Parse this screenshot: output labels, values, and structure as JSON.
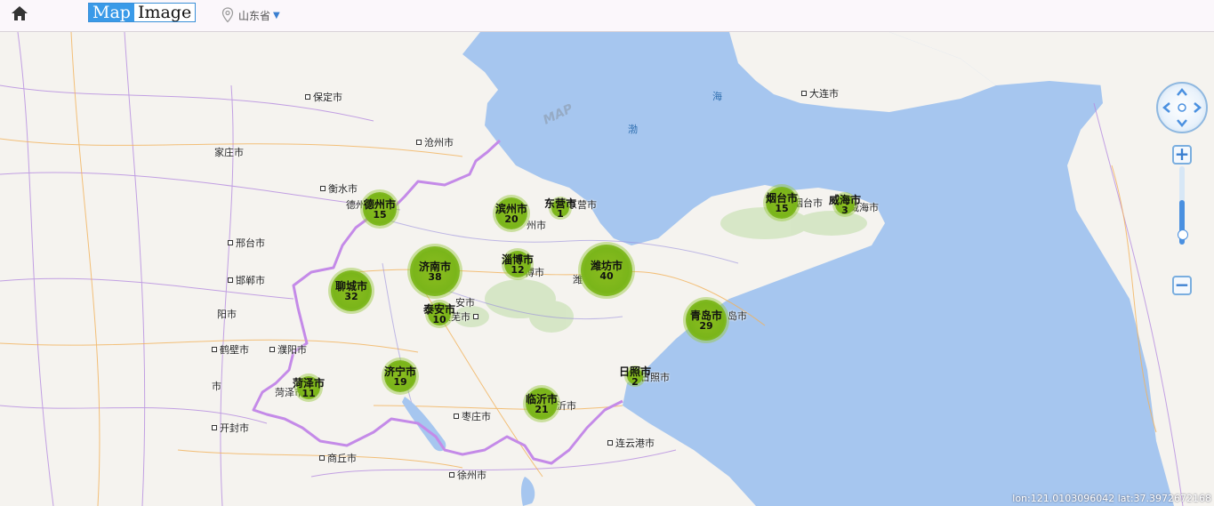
{
  "toolbar": {
    "home_icon": "home-icon",
    "map_option": "Map",
    "image_option": "Image",
    "selected_option": "Map",
    "region_icon": "location-pin-icon",
    "region": "山东省",
    "region_caret": "▼"
  },
  "map": {
    "watermark": "MAP",
    "seas": [
      "海",
      "渤"
    ],
    "city_labels": [
      "保定市",
      "沧州市",
      "家庄市",
      "衡水市",
      "德州市",
      "邢台市",
      "邯郸市",
      "阳市",
      "鹤壁市",
      "濮阳市",
      "市",
      "开封市",
      "商丘市",
      "徐州市",
      "枣庄市",
      "连云港市",
      "大连市",
      "东营市",
      "烟台市",
      "威海市",
      "潍",
      "莱芜市",
      "安市",
      "日照市",
      "沂市",
      "州市",
      "博市",
      "岛市",
      "菏泽市"
    ],
    "clusters": [
      {
        "name": "德州市",
        "count": "15"
      },
      {
        "name": "滨州市",
        "count": "20"
      },
      {
        "name": "东营市",
        "count": "1"
      },
      {
        "name": "烟台市",
        "count": "15"
      },
      {
        "name": "威海市",
        "count": "3"
      },
      {
        "name": "济南市",
        "count": "38"
      },
      {
        "name": "淄博市",
        "count": "12"
      },
      {
        "name": "潍坊市",
        "count": "40"
      },
      {
        "name": "聊城市",
        "count": "32"
      },
      {
        "name": "泰安市",
        "count": "10"
      },
      {
        "name": "青岛市",
        "count": "29"
      },
      {
        "name": "日照市",
        "count": "2"
      },
      {
        "name": "济宁市",
        "count": "19"
      },
      {
        "name": "菏泽市",
        "count": "11"
      },
      {
        "name": "临沂市",
        "count": "21"
      }
    ],
    "controls": {
      "pan_icon": "pan-compass-icon",
      "zoom_in": "+",
      "zoom_out": "−"
    },
    "coordinates": "lon:121.0103096042 lat:37.3972672168",
    "colors": {
      "sea": "#a6c6ef",
      "land": "#f5f3ef",
      "province_border": "#c48ae8",
      "cluster": "#7ab51a",
      "toggle_active": "#3a9ae8"
    }
  }
}
